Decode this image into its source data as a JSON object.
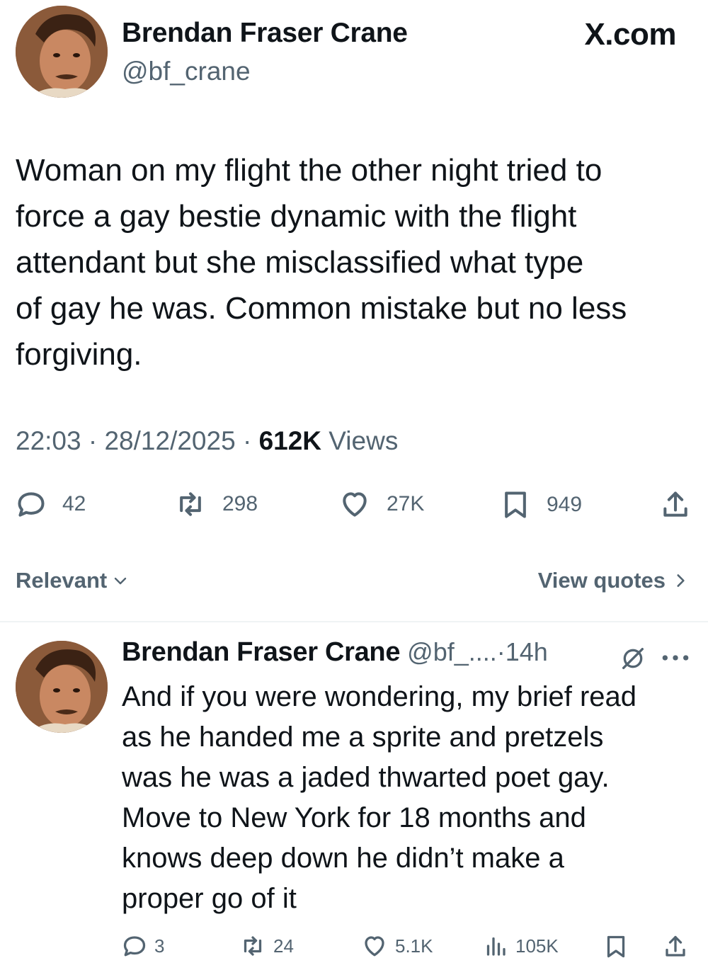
{
  "site_label": "X.com",
  "main_tweet": {
    "author_name": "Brendan Fraser Crane",
    "author_handle": "@bf_crane",
    "text_lines": [
      "Woman on my flight the other night tried to",
      "force a gay bestie dynamic with the flight",
      "attendant but she misclassified what type",
      "of gay he was. Common mistake but no less",
      "forgiving."
    ],
    "time": "22:03",
    "date": "28/12/2025",
    "views_count": "612K",
    "views_label": "Views",
    "separator": "·",
    "replies": "42",
    "reposts": "298",
    "likes": "27K",
    "bookmarks": "949"
  },
  "sort_bar": {
    "relevant_label": "Relevant",
    "view_quotes_label": "View quotes"
  },
  "reply_tweet": {
    "author_name": "Brendan Fraser Crane",
    "author_handle": "@bf_....",
    "separator": "·",
    "age": "14h",
    "text_lines": [
      "And if you were wondering, my brief read",
      "as he handed me a sprite and pretzels",
      "was he was a jaded thwarted poet gay.",
      "Move to New York for 18 months and",
      "knows deep down he didn’t make a",
      "proper go of it"
    ],
    "replies": "3",
    "reposts": "24",
    "likes": "5.1K",
    "views": "105K"
  },
  "icons": {
    "reply": "reply-icon",
    "repost": "repost-icon",
    "like": "heart-icon",
    "bookmark": "bookmark-icon",
    "share": "share-icon",
    "views": "views-chart-icon",
    "grok": "grok-icon",
    "more": "more-dots-icon",
    "chevron_down": "chevron-down-icon",
    "chevron_right": "chevron-right-icon"
  },
  "colors": {
    "text_primary": "#0f1419",
    "text_secondary": "#536471",
    "divider": "#eff3f4",
    "background": "#ffffff"
  }
}
